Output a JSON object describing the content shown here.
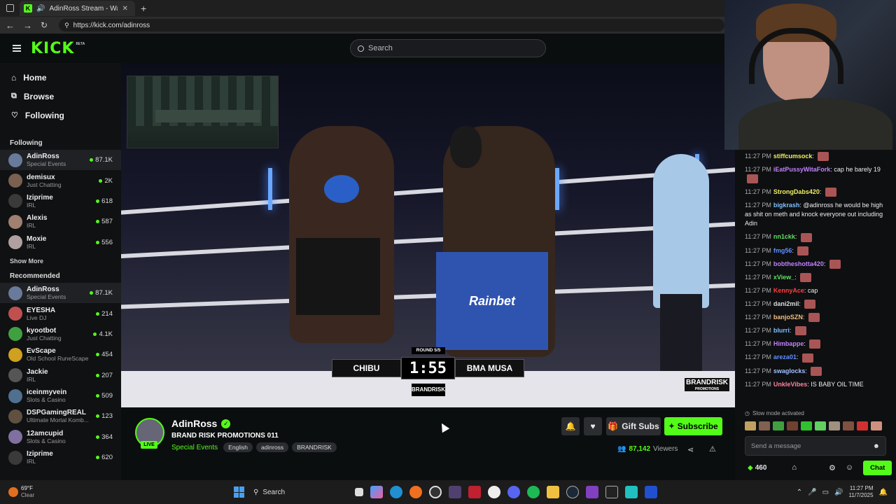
{
  "browser": {
    "tab_title": "AdinRoss Stream - Watch Li...",
    "url": "https://kick.com/adinross"
  },
  "header": {
    "logo_text": "KICK",
    "logo_badge": "BETA",
    "search_placeholder": "Search"
  },
  "sidebar": {
    "nav": [
      {
        "label": "Home",
        "icon": "home-icon"
      },
      {
        "label": "Browse",
        "icon": "browse-icon"
      },
      {
        "label": "Following",
        "icon": "heart-icon"
      }
    ],
    "following_title": "Following",
    "following": [
      {
        "name": "AdinRoss",
        "category": "Special Events",
        "viewers": "87.1K",
        "color": "#6a7a9a"
      },
      {
        "name": "demisux",
        "category": "Just Chatting",
        "viewers": "2K",
        "color": "#7a6050"
      },
      {
        "name": "Iziprime",
        "category": "IRL",
        "viewers": "618",
        "color": "#3a3a3a"
      },
      {
        "name": "Alexis",
        "category": "IRL",
        "viewers": "587",
        "color": "#a08070"
      },
      {
        "name": "Moxie",
        "category": "IRL",
        "viewers": "556",
        "color": "#b0a0a0"
      }
    ],
    "show_more": "Show More",
    "recommended_title": "Recommended",
    "recommended": [
      {
        "name": "AdinRoss",
        "category": "Special Events",
        "viewers": "87.1K",
        "color": "#6a7a9a"
      },
      {
        "name": "EYESHA",
        "category": "Live DJ",
        "viewers": "214",
        "color": "#c05050"
      },
      {
        "name": "kyootbot",
        "category": "Just Chatting",
        "viewers": "4.1K",
        "color": "#40a040"
      },
      {
        "name": "EvScape",
        "category": "Old School RuneScape",
        "viewers": "454",
        "color": "#d0a020"
      },
      {
        "name": "Jackie",
        "category": "IRL",
        "viewers": "207",
        "color": "#555"
      },
      {
        "name": "iceinmyvein",
        "category": "Slots & Casino",
        "viewers": "509",
        "color": "#507090"
      },
      {
        "name": "DSPGamingREAL",
        "category": "Ultimate Mortal Komb...",
        "viewers": "123",
        "color": "#605040"
      },
      {
        "name": "12amcupid",
        "category": "Slots & Casino",
        "viewers": "364",
        "color": "#8070a0"
      },
      {
        "name": "Iziprime",
        "category": "IRL",
        "viewers": "620",
        "color": "#3a3a3a"
      }
    ]
  },
  "video": {
    "round": "ROUND 5/5",
    "fighter_left": "CHIBU",
    "timer": "1:55",
    "fighter_right": "BMA MUSA",
    "promo_center": "BRANDRISK",
    "promo_corner": "BRANDRISK",
    "promo_corner_sub": "PROMOTIONS",
    "trunks_text": "Rainbet"
  },
  "stream_info": {
    "channel": "AdinRoss",
    "live": "LIVE",
    "title": "BRAND RISK PROMOTIONS 011",
    "category": "Special Events",
    "tags": [
      "English",
      "adinross",
      "BRANDRISK"
    ],
    "gift_label": "Gift Subs",
    "subscribe_label": "Subscribe",
    "viewers": "87,142",
    "viewers_label": "Viewers"
  },
  "chat": {
    "messages": [
      {
        "time": "11:27 PM",
        "user": "stiffcumsock",
        "color": "#f0f060",
        "text": "",
        "emote": true
      },
      {
        "time": "11:27 PM",
        "user": "iEatPussyWitaFork",
        "color": "#c080ff",
        "text": "cap he barely 19",
        "emote": true
      },
      {
        "time": "11:27 PM",
        "user": "StrongDabs420",
        "color": "#f0f060",
        "text": "",
        "emote": true
      },
      {
        "time": "11:27 PM",
        "user": "bigkrash",
        "color": "#80c0ff",
        "text": "@adinross he would be high as shit on meth and knock everyone out including Adin",
        "emote": false
      },
      {
        "time": "11:27 PM",
        "user": "nn1ckk",
        "color": "#60e060",
        "text": "",
        "emote": true
      },
      {
        "time": "11:27 PM",
        "user": "fmg56",
        "color": "#6090ff",
        "text": "",
        "emote": true
      },
      {
        "time": "11:27 PM",
        "user": "bobtheshotta420",
        "color": "#c080ff",
        "text": "",
        "emote": true
      },
      {
        "time": "11:27 PM",
        "user": "xView_",
        "color": "#60e060",
        "text": "",
        "emote": true
      },
      {
        "time": "11:27 PM",
        "user": "KennyAce",
        "color": "#ff4040",
        "text": "cap",
        "emote": false
      },
      {
        "time": "11:27 PM",
        "user": "dani2mil",
        "color": "#dddddd",
        "text": "",
        "emote": true
      },
      {
        "time": "11:27 PM",
        "user": "banjoSZN",
        "color": "#f0c080",
        "text": "",
        "emote": true
      },
      {
        "time": "11:27 PM",
        "user": "blurri",
        "color": "#80c0ff",
        "text": "",
        "emote": true
      },
      {
        "time": "11:27 PM",
        "user": "Himbappe",
        "color": "#c080ff",
        "text": "",
        "emote": true
      },
      {
        "time": "11:27 PM",
        "user": "areza01",
        "color": "#6090ff",
        "text": "",
        "emote": true
      },
      {
        "time": "11:27 PM",
        "user": "swaglocks",
        "color": "#a0c0ff",
        "text": "",
        "emote": true
      },
      {
        "time": "11:27 PM",
        "user": "UnkleVibes",
        "color": "#ff80a0",
        "text": "IS BABY OIL TIME",
        "emote": false
      }
    ],
    "slow_mode": "Slow mode activated",
    "input_placeholder": "Send a message",
    "points": "460",
    "chat_button": "Chat"
  },
  "taskbar": {
    "weather_temp": "69°F",
    "weather_desc": "Clear",
    "search_label": "Search",
    "time": "11:27 PM",
    "date": "11/7/2025"
  },
  "colors": {
    "accent": "#53fc18",
    "background": "#0b0e0f",
    "sidebar": "#101113"
  }
}
